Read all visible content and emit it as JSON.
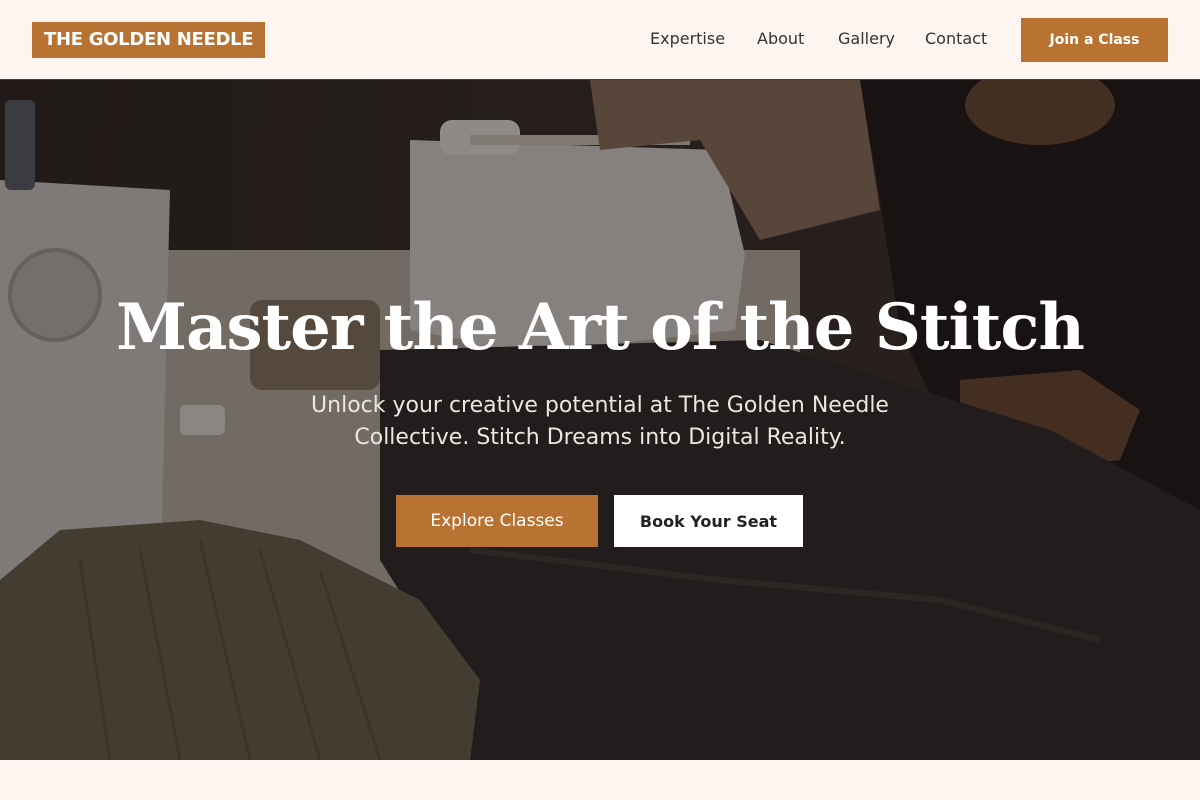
{
  "header": {
    "logo_text": "THE GOLDEN NEEDLE",
    "nav": [
      {
        "label": "Expertise"
      },
      {
        "label": "About"
      },
      {
        "label": "Gallery"
      },
      {
        "label": "Contact"
      }
    ],
    "cta_label": "Join a Class"
  },
  "hero": {
    "title": "Master the Art of the Stitch",
    "subtitle": "Unlock your creative potential at The Golden Needle Collective. Stitch Dreams into Digital Reality.",
    "primary_button": "Explore Classes",
    "secondary_button": "Book Your Seat",
    "background_image": "sewing-workshop-photo"
  },
  "colors": {
    "accent": "#b87333",
    "page_background": "#fdf6f0",
    "nav_text": "#333333",
    "hero_text": "#ffffff"
  }
}
